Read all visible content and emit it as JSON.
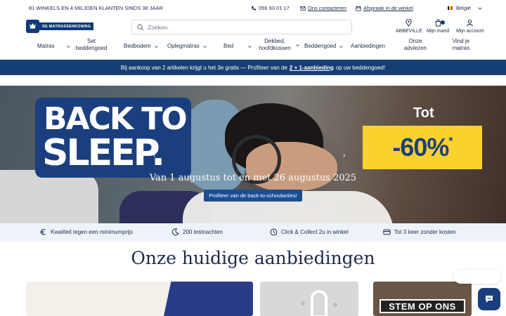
{
  "topbar": {
    "claim": "81 WINKELS EN 4 MILJOEN KLANTEN SINDS 38 JAAR",
    "phone": "056 93 01 17",
    "contact": "Ons contacteren",
    "appointment": "Afspraak in de winkel",
    "country": "België"
  },
  "header": {
    "logo_text": "DE MATRASSENKONING",
    "search_placeholder": "Zoeken",
    "store_label": "ABBEVILLE",
    "cart_label": "Mijn mand",
    "account_label": "Mijn account"
  },
  "nav": {
    "items": [
      {
        "label": "Matras"
      },
      {
        "label": "Set beddengoed"
      },
      {
        "label": "Bedbodem"
      },
      {
        "label": "Oplegmatras"
      },
      {
        "label": "Bed"
      },
      {
        "label": "Dekbed, hoofdkussen"
      },
      {
        "label": "Beddengoed"
      },
      {
        "label": "Aanbiedingen"
      },
      {
        "label": "Onze adviezen"
      },
      {
        "label": "Vind je matras"
      }
    ]
  },
  "promo": {
    "text_before": "Bij aankoop van 2 artikelen krijgt u het 3e gratis — Profiteer van de",
    "link": "2 + 1-aanbieding",
    "text_after": "op uw beddengoed!"
  },
  "hero": {
    "line1": "BACK TO",
    "line2": "SLEEP.",
    "tot": "Tot",
    "discount": "-60%",
    "asterisk": "*",
    "date": "Van 1 augustus tot en met 26 augustus 2025",
    "cta": "Profiteer van de back-to-schoolacties!"
  },
  "usp": {
    "items": [
      {
        "label": "Kwaliteit tegen een minimumprijs"
      },
      {
        "label": "200 testnachten"
      },
      {
        "label": "Click & Collect 2u in winkel"
      },
      {
        "label": "Tot 3 keer zonder kosten"
      }
    ]
  },
  "section": {
    "title": "Onze huidige aanbiedingen",
    "card3_text": "STEM OP ONS"
  },
  "colors": {
    "brand_blue": "#173e72",
    "yellow": "#f9d22d",
    "usp_bg": "#eef3fa"
  }
}
